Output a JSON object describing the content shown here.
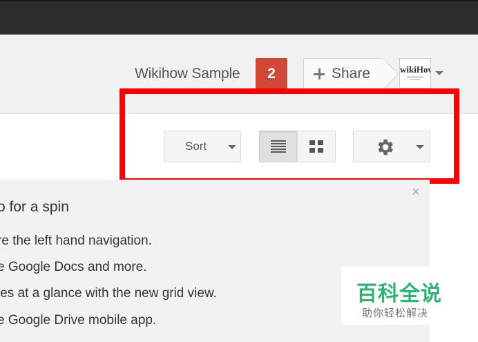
{
  "header": {
    "username": "Wikihow Sample",
    "notifications_count": "2",
    "share_label": "Share",
    "avatar_text": "wikiHow"
  },
  "toolbar": {
    "sort_label": "Sort"
  },
  "banner": {
    "title": "o for a spin",
    "lines": [
      "re the left hand navigation.",
      "e Google Docs and more.",
      "les at a glance with the new grid view.",
      "e Google Drive mobile app."
    ],
    "close_glyph": "×"
  },
  "watermark": {
    "main": "百科全说",
    "sub": "助你轻松解决"
  },
  "colors": {
    "notification": "#d14836",
    "highlight": "#ff0000",
    "topbar": "#2d2d2d",
    "watermark": "#2bb673"
  },
  "icons": [
    "plus-icon",
    "chevron-down-icon",
    "list-view-icon",
    "grid-view-icon",
    "gear-icon",
    "close-icon"
  ]
}
